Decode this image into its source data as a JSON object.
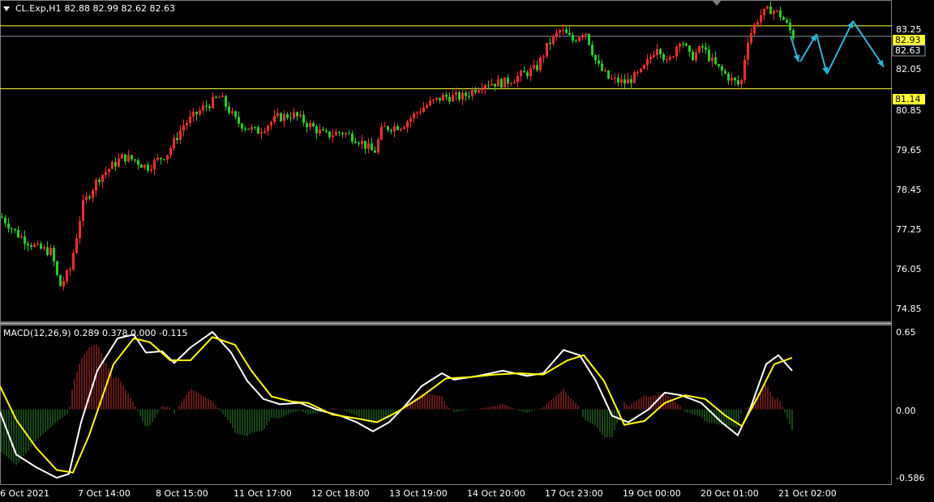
{
  "header": {
    "symbol": "CL.Exp,H1",
    "ohlc": "82.88 82.99 82.62 82.63"
  },
  "macd": {
    "label": "MACD(12,26,9) 0.289 0.378 0.000 -0.115"
  },
  "price_axis": [
    "83.25",
    "82.05",
    "80.85",
    "79.65",
    "78.45",
    "77.25",
    "76.05",
    "74.85"
  ],
  "hlines": [
    {
      "price": 82.93,
      "label": "82.93",
      "color": "#ffff33"
    },
    {
      "price": 82.63,
      "label": "82.63",
      "color": "#8899aa"
    },
    {
      "price": 81.14,
      "label": "81.14",
      "color": "#ffff33"
    }
  ],
  "macd_axis": [
    "0.65",
    "0.00",
    "-0.586"
  ],
  "time_axis": [
    "6 Oct 2021",
    "7 Oct 14:00",
    "8 Oct 15:00",
    "11 Oct 17:00",
    "12 Oct 18:00",
    "13 Oct 19:00",
    "14 Oct 20:00",
    "17 Oct 23:00",
    "19 Oct 00:00",
    "20 Oct 01:00",
    "21 Oct 02:00"
  ],
  "colors": {
    "bull": "#ff2a2a",
    "bear": "#22d022",
    "hist_up": "#c83030",
    "hist_down": "#2f8a2f",
    "macd_line": "#ffffff",
    "signal_line": "#ffff00",
    "arrow": "#29b6d6",
    "hline": "#ffff33"
  },
  "chart_data": {
    "type": "candlestick",
    "symbol": "CL.Exp",
    "timeframe": "H1",
    "price_range": [
      74.5,
      83.65
    ],
    "macd_range": [
      -0.586,
      0.65
    ],
    "price_path": [
      [
        0,
        77.5
      ],
      [
        20,
        77.0
      ],
      [
        45,
        76.6
      ],
      [
        62,
        76.5
      ],
      [
        72,
        75.5
      ],
      [
        85,
        76.0
      ],
      [
        100,
        77.8
      ],
      [
        120,
        78.6
      ],
      [
        150,
        79.2
      ],
      [
        165,
        79.1
      ],
      [
        180,
        78.9
      ],
      [
        205,
        79.3
      ],
      [
        225,
        80.1
      ],
      [
        250,
        80.6
      ],
      [
        270,
        80.9
      ],
      [
        290,
        80.2
      ],
      [
        315,
        79.9
      ],
      [
        340,
        80.3
      ],
      [
        360,
        80.4
      ],
      [
        380,
        80.1
      ],
      [
        400,
        79.8
      ],
      [
        420,
        79.9
      ],
      [
        440,
        79.7
      ],
      [
        460,
        79.3
      ],
      [
        470,
        80.0
      ],
      [
        495,
        80.1
      ],
      [
        520,
        80.6
      ],
      [
        545,
        80.9
      ],
      [
        570,
        80.9
      ],
      [
        595,
        81.3
      ],
      [
        620,
        81.3
      ],
      [
        640,
        81.5
      ],
      [
        660,
        81.7
      ],
      [
        675,
        82.4
      ],
      [
        690,
        82.8
      ],
      [
        705,
        82.5
      ],
      [
        720,
        82.8
      ],
      [
        735,
        81.8
      ],
      [
        750,
        81.4
      ],
      [
        770,
        81.3
      ],
      [
        790,
        81.6
      ],
      [
        810,
        82.4
      ],
      [
        822,
        81.8
      ],
      [
        838,
        82.6
      ],
      [
        850,
        82.0
      ],
      [
        865,
        82.3
      ],
      [
        880,
        81.8
      ],
      [
        900,
        81.4
      ],
      [
        912,
        81.2
      ],
      [
        920,
        82.5
      ],
      [
        935,
        83.2
      ],
      [
        950,
        83.4
      ],
      [
        962,
        83.2
      ],
      [
        977,
        82.63
      ]
    ],
    "macd": [
      [
        0,
        -0.02
      ],
      [
        20,
        -0.35
      ],
      [
        45,
        -0.45
      ],
      [
        70,
        -0.53
      ],
      [
        85,
        -0.5
      ],
      [
        100,
        -0.1
      ],
      [
        120,
        0.3
      ],
      [
        145,
        0.55
      ],
      [
        165,
        0.58
      ],
      [
        180,
        0.44
      ],
      [
        200,
        0.45
      ],
      [
        215,
        0.36
      ],
      [
        235,
        0.48
      ],
      [
        262,
        0.6
      ],
      [
        285,
        0.44
      ],
      [
        305,
        0.22
      ],
      [
        325,
        0.08
      ],
      [
        345,
        0.04
      ],
      [
        370,
        0.05
      ],
      [
        390,
        0.0
      ],
      [
        420,
        -0.05
      ],
      [
        440,
        -0.1
      ],
      [
        460,
        -0.17
      ],
      [
        480,
        -0.1
      ],
      [
        500,
        0.03
      ],
      [
        520,
        0.18
      ],
      [
        545,
        0.28
      ],
      [
        560,
        0.23
      ],
      [
        590,
        0.26
      ],
      [
        620,
        0.3
      ],
      [
        650,
        0.26
      ],
      [
        670,
        0.28
      ],
      [
        695,
        0.46
      ],
      [
        715,
        0.42
      ],
      [
        735,
        0.22
      ],
      [
        755,
        -0.05
      ],
      [
        775,
        -0.1
      ],
      [
        800,
        0.0
      ],
      [
        820,
        0.13
      ],
      [
        840,
        0.11
      ],
      [
        865,
        0.05
      ],
      [
        890,
        -0.1
      ],
      [
        910,
        -0.2
      ],
      [
        925,
        0.0
      ],
      [
        945,
        0.35
      ],
      [
        960,
        0.42
      ],
      [
        977,
        0.3
      ]
    ],
    "signal": [
      [
        0,
        0.18
      ],
      [
        20,
        -0.08
      ],
      [
        45,
        -0.3
      ],
      [
        70,
        -0.47
      ],
      [
        90,
        -0.49
      ],
      [
        110,
        -0.2
      ],
      [
        140,
        0.35
      ],
      [
        165,
        0.55
      ],
      [
        185,
        0.52
      ],
      [
        210,
        0.38
      ],
      [
        235,
        0.38
      ],
      [
        262,
        0.56
      ],
      [
        290,
        0.5
      ],
      [
        310,
        0.3
      ],
      [
        335,
        0.1
      ],
      [
        360,
        0.06
      ],
      [
        380,
        0.05
      ],
      [
        410,
        -0.04
      ],
      [
        440,
        -0.07
      ],
      [
        465,
        -0.1
      ],
      [
        490,
        -0.02
      ],
      [
        520,
        0.1
      ],
      [
        550,
        0.24
      ],
      [
        580,
        0.25
      ],
      [
        610,
        0.27
      ],
      [
        640,
        0.28
      ],
      [
        670,
        0.27
      ],
      [
        700,
        0.38
      ],
      [
        720,
        0.42
      ],
      [
        745,
        0.22
      ],
      [
        770,
        -0.12
      ],
      [
        795,
        -0.09
      ],
      [
        820,
        0.05
      ],
      [
        845,
        0.11
      ],
      [
        870,
        0.08
      ],
      [
        895,
        -0.05
      ],
      [
        915,
        -0.13
      ],
      [
        935,
        0.1
      ],
      [
        955,
        0.35
      ],
      [
        977,
        0.4
      ]
    ],
    "forecast_arrows": [
      [
        [
          975,
          82.63
        ],
        [
          985,
          81.9
        ]
      ],
      [
        [
          987,
          81.9
        ],
        [
          1007,
          82.68
        ]
      ],
      [
        [
          1007,
          82.68
        ],
        [
          1020,
          81.55
        ]
      ],
      [
        [
          1020,
          81.55
        ],
        [
          1052,
          83.05
        ]
      ],
      [
        [
          1052,
          83.05
        ],
        [
          1090,
          81.75
        ]
      ]
    ]
  }
}
